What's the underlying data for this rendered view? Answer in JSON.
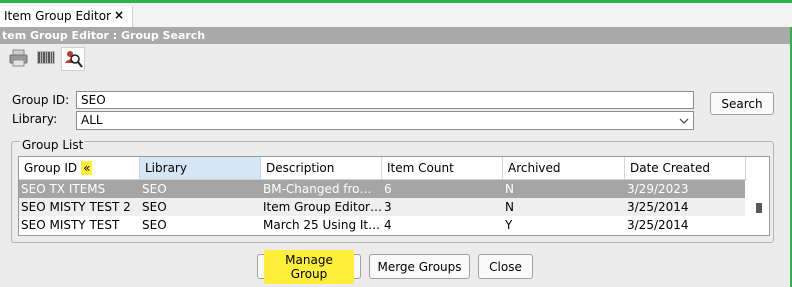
{
  "window": {
    "tab_title": "Item Group Editor",
    "tab_close": "×",
    "panel_title": "tem Group Editor : Group Search"
  },
  "toolbar": {
    "icons": [
      "print-icon",
      "barcode-icon",
      "people-search-icon"
    ]
  },
  "form": {
    "group_id_label": "Group ID:",
    "group_id_value": "SEO",
    "library_label": "Library:",
    "library_value": "ALL",
    "search_button": "Search"
  },
  "group_list": {
    "legend": "Group List",
    "sort_indicator": "«",
    "columns": [
      "Group ID",
      "Library",
      "Description",
      "Item Count",
      "Archived",
      "Date Created"
    ],
    "rows": [
      [
        "SEO TX ITEMS",
        "SEO",
        "BM-Changed from...",
        "6",
        "N",
        "3/29/2023"
      ],
      [
        "SEO MISTY TEST 2",
        "SEO",
        "Item Group Editor ...",
        "3",
        "N",
        "3/25/2014"
      ],
      [
        "SEO MISTY TEST",
        "SEO",
        "March 25 Using Ite...",
        "4",
        "Y",
        "3/25/2014"
      ]
    ]
  },
  "footer": {
    "manage_group": "Manage Group",
    "merge_groups": "Merge Groups",
    "close": "Close"
  },
  "colors": {
    "accent_green": "#2db34a",
    "highlight_yellow": "#ffef3a",
    "selected_row": "#a5a5a5",
    "panel_header": "#a9a9a9"
  }
}
